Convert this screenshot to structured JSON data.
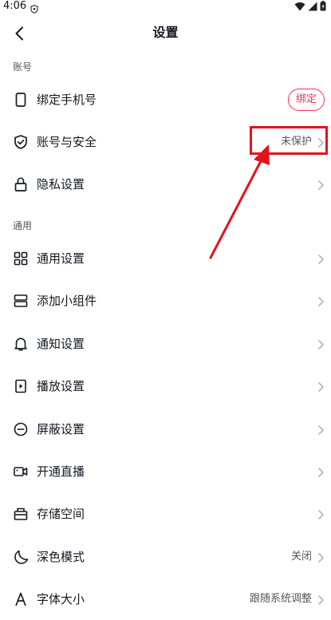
{
  "status_bar": {
    "time": "4:06"
  },
  "header": {
    "title": "设置"
  },
  "sections": {
    "account_header": "账号",
    "general_header": "通用"
  },
  "rows": {
    "bind_phone": {
      "label": "绑定手机号",
      "action": "绑定"
    },
    "account_security": {
      "label": "账号与安全",
      "value": "未保护"
    },
    "privacy": {
      "label": "隐私设置"
    },
    "general_settings": {
      "label": "通用设置"
    },
    "add_widget": {
      "label": "添加小组件"
    },
    "notifications": {
      "label": "通知设置"
    },
    "playback": {
      "label": "播放设置"
    },
    "block": {
      "label": "屏蔽设置"
    },
    "live": {
      "label": "开通直播"
    },
    "storage": {
      "label": "存储空间"
    },
    "dark_mode": {
      "label": "深色模式",
      "value": "关闭"
    },
    "font_size": {
      "label": "字体大小",
      "value": "跟随系统调整"
    }
  },
  "colors": {
    "accent": "#fe2c55",
    "annotation": "#e3131b"
  }
}
